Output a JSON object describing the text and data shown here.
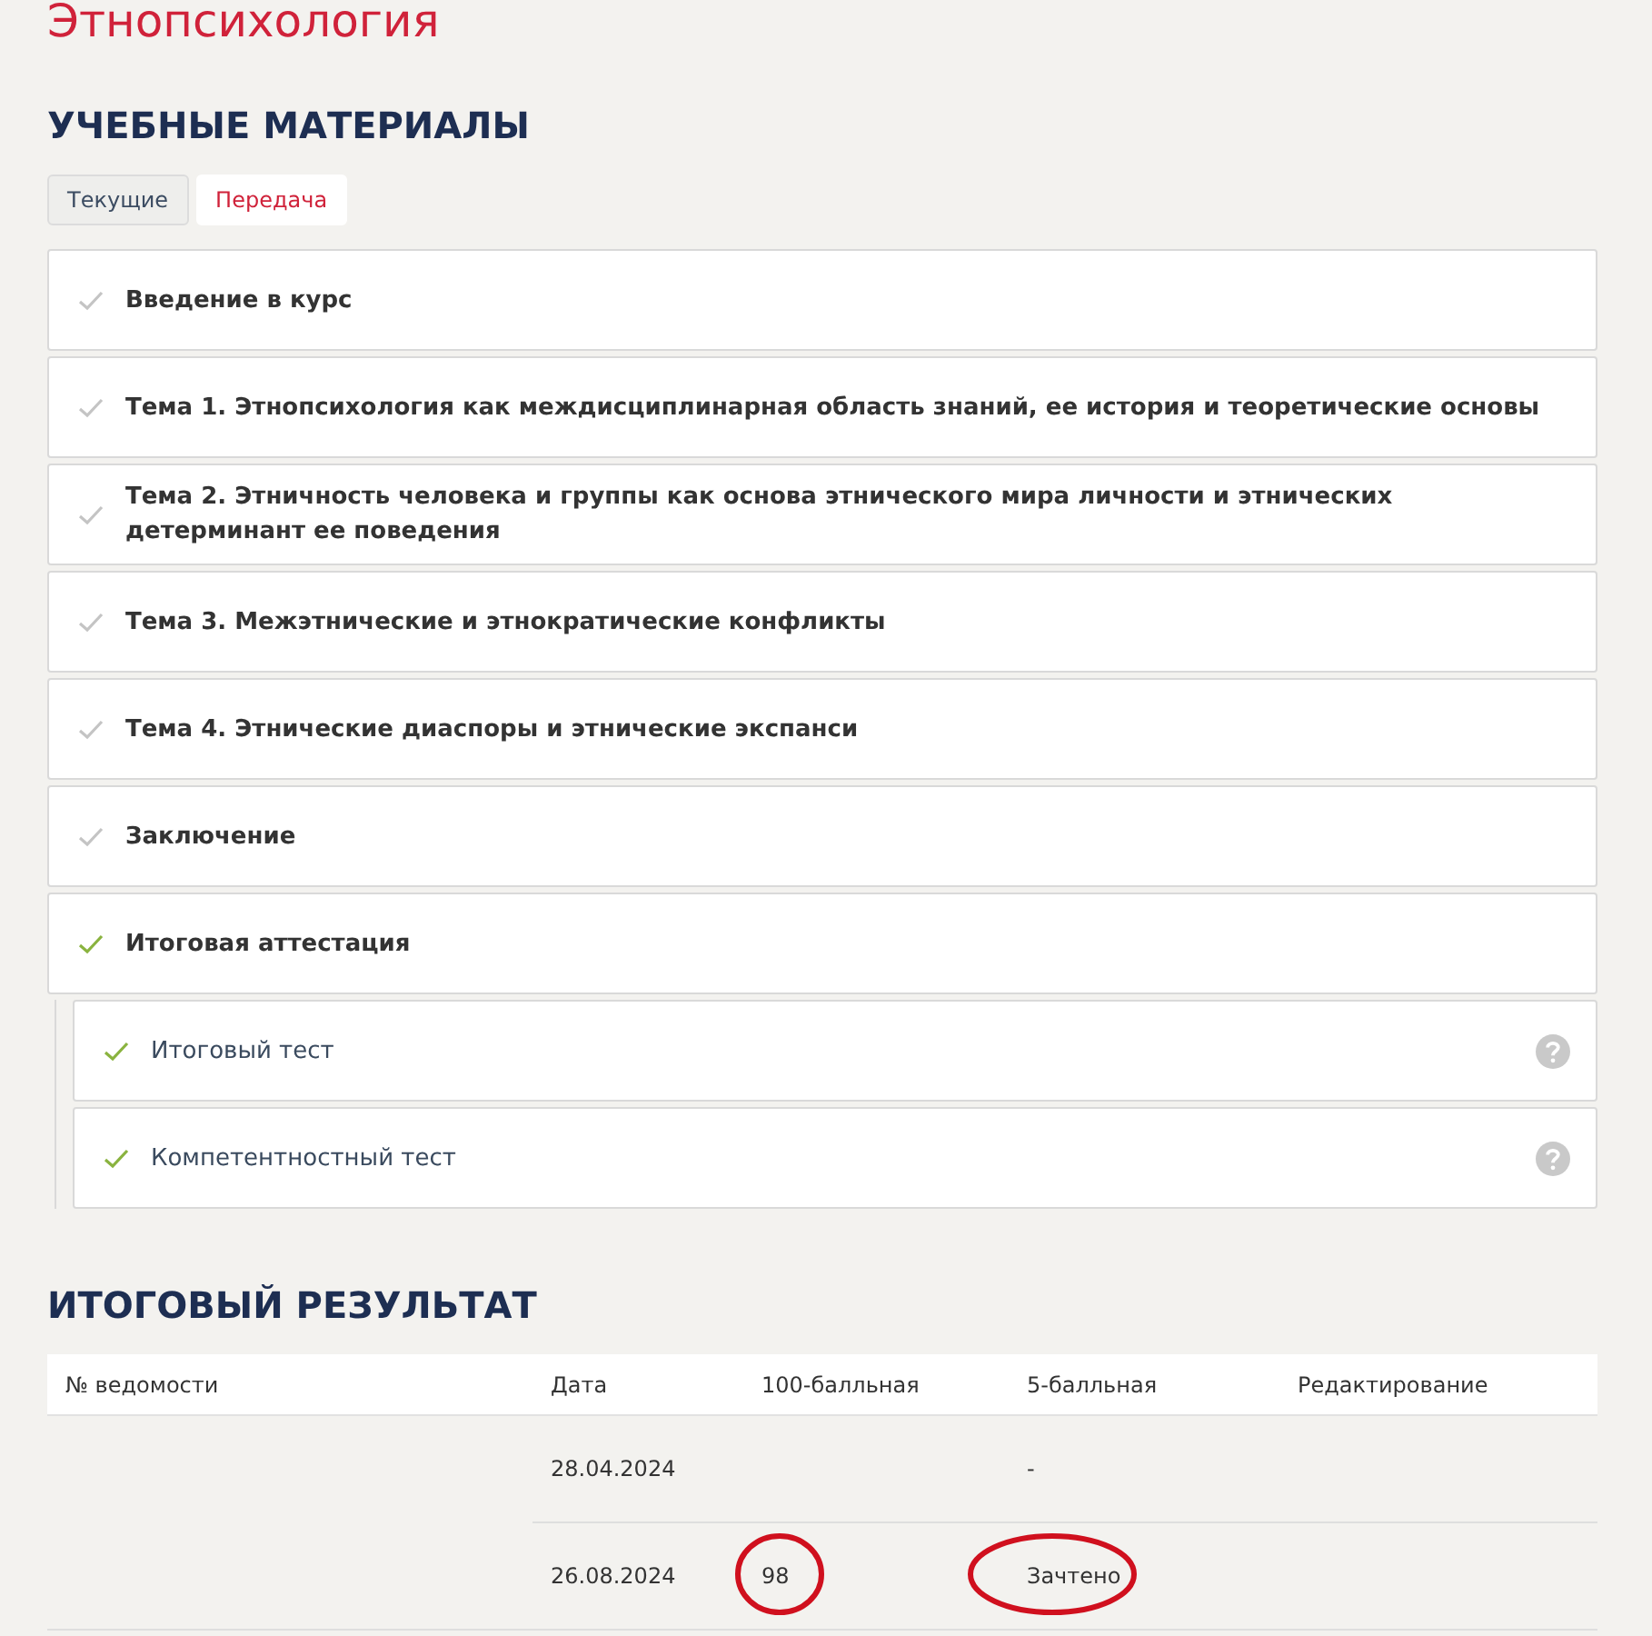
{
  "course_title": "Этнопсихология",
  "materials": {
    "heading": "УЧЕБНЫЕ МАТЕРИАЛЫ",
    "tabs": [
      {
        "label": "Текущие",
        "selected": false
      },
      {
        "label": "Передача",
        "selected": true
      }
    ],
    "items": [
      {
        "title": "Введение в курс",
        "passed": false
      },
      {
        "title": "Тема 1. Этнопсихология как междисциплинарная область знаний, ее история и теоретические основы",
        "passed": false
      },
      {
        "title": "Тема 2. Этничность человека и группы как основа этнического мира личности и этнических детерминант ее поведения",
        "passed": false
      },
      {
        "title": "Тема 3. Межэтнические и этнократические конфликты",
        "passed": false
      },
      {
        "title": "Тема 4. Этнические диаспоры и этнические экспанси",
        "passed": false
      },
      {
        "title": "Заключение",
        "passed": false
      },
      {
        "title": "Итоговая аттестация",
        "passed": true,
        "expanded": true,
        "children": [
          {
            "title": "Итоговый тест",
            "passed": true
          },
          {
            "title": "Компетентностный тест",
            "passed": true
          }
        ]
      }
    ]
  },
  "result": {
    "heading": "ИТОГОВЫЙ РЕЗУЛЬТАТ",
    "columns": [
      "№ ведомости",
      "Дата",
      "100-балльная",
      "5-балльная",
      "Редактирование"
    ],
    "rows": [
      {
        "date": {
          "text": "28.04.2024",
          "circled": false
        },
        "score_5": {
          "text": "-",
          "circled": false
        }
      },
      {
        "date": {
          "text": "26.08.2024",
          "circled": false
        },
        "score_100": {
          "text": "98",
          "circled": true
        },
        "score_5": {
          "text": "Зачтено",
          "circled": true
        }
      }
    ]
  }
}
